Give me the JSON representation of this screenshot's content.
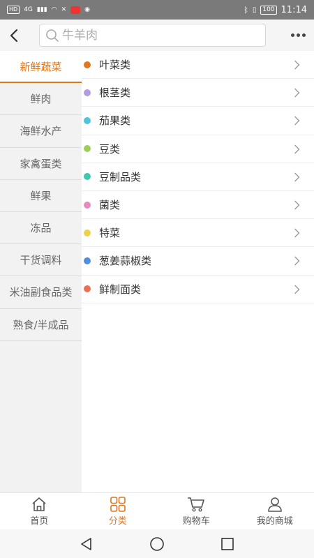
{
  "status_bar": {
    "network": "4G",
    "battery": "100",
    "time": "11:14"
  },
  "search": {
    "placeholder": "牛羊肉"
  },
  "sidebar": {
    "items": [
      {
        "label": "新鲜蔬菜",
        "active": true
      },
      {
        "label": "鲜肉"
      },
      {
        "label": "海鲜水产"
      },
      {
        "label": "家禽蛋类"
      },
      {
        "label": "鲜果"
      },
      {
        "label": "冻品"
      },
      {
        "label": "干货调料"
      },
      {
        "label": "米油副食品类"
      },
      {
        "label": "熟食/半成品"
      }
    ]
  },
  "subcategories": {
    "items": [
      {
        "label": "叶菜类",
        "color": "#e8741e"
      },
      {
        "label": "根茎类",
        "color": "#b29be0"
      },
      {
        "label": "茄果类",
        "color": "#4fc3e0"
      },
      {
        "label": "豆类",
        "color": "#9ccf5a"
      },
      {
        "label": "豆制品类",
        "color": "#3fc8b0"
      },
      {
        "label": "菌类",
        "color": "#e68ac0"
      },
      {
        "label": "特菜",
        "color": "#f3d04a"
      },
      {
        "label": "葱姜蒜椒类",
        "color": "#4f8fe0"
      },
      {
        "label": "鲜制面类",
        "color": "#ef6f55"
      }
    ]
  },
  "bottom_nav": {
    "home": "首页",
    "category": "分类",
    "cart": "购物车",
    "mine": "我的商城"
  },
  "colors": {
    "accent": "#e0761b"
  }
}
